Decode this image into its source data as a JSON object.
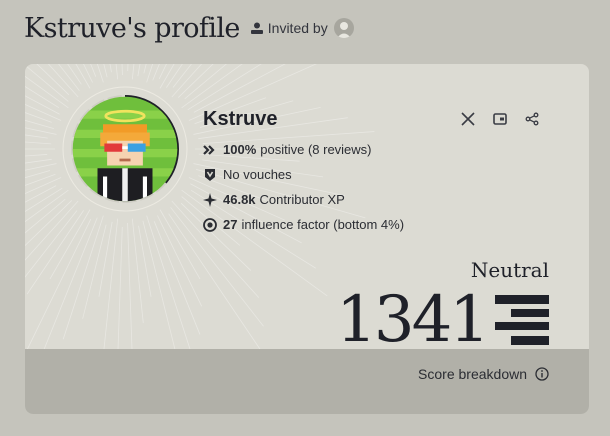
{
  "header": {
    "title": "Kstruve's profile",
    "invited_label": "Invited by"
  },
  "profile": {
    "name": "Kstruve",
    "stats": [
      {
        "bold": "100%",
        "text": "positive (8 reviews)",
        "icon": "double-chevron-icon"
      },
      {
        "bold": "",
        "text": "No vouches",
        "icon": "vouch-shield-icon"
      },
      {
        "bold": "46.8k",
        "text": "Contributor XP",
        "icon": "sparkle-icon"
      },
      {
        "bold": "27",
        "text": "influence factor (bottom 4%)",
        "icon": "influence-ring-icon"
      }
    ],
    "score_progress": 0.36
  },
  "actions": [
    {
      "name": "x-share-button",
      "icon": "x-logo-icon"
    },
    {
      "name": "wallet-button",
      "icon": "wallet-icon"
    },
    {
      "name": "share-button",
      "icon": "share-icon"
    }
  ],
  "score": {
    "level": "Neutral",
    "value": "1341",
    "breakdown_label": "Score breakdown"
  },
  "colors": {
    "background": "#c5c4bc",
    "card": "#dcdbd3",
    "band": "#b1b0a8",
    "text": "#1f2129"
  }
}
